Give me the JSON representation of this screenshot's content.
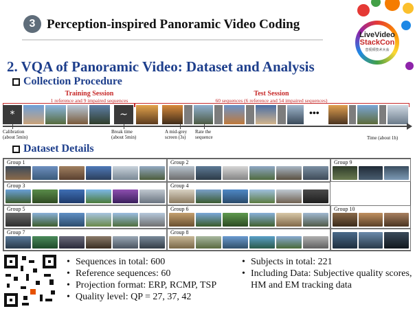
{
  "header": {
    "section_number": "3",
    "title": "Perception-inspired Panoramic Video Coding"
  },
  "logo": {
    "line1": "LiveVideo",
    "line2": "StackCon",
    "line3": "音视频技术大会"
  },
  "slide_title": "2. VQA of Panoramic Video: Dataset and Analysis",
  "collection": {
    "heading": "Collection Procedure",
    "training_label": "Training Session",
    "training_note": "1 reference and 9 impaired sequences",
    "test_label": "Test Session",
    "test_note": "60 sequences (6 reference and 54 impaired sequences)",
    "calibration_symbol": "*",
    "break_symbol": "~",
    "ellipsis": "•••",
    "calibration_line1": "Calibration",
    "calibration_line2": "(about 5min)",
    "break_line1": "Break time",
    "break_line2": "(about 5min)",
    "grey_line1": "A mid-grey",
    "grey_line2": "screen (3s)",
    "rate_line1": "Rate the",
    "rate_line2": "sequence",
    "time_note": "Time (about 1h)"
  },
  "details": {
    "heading": "Dataset Details",
    "groups": [
      "Group 1",
      "Group 2",
      "Group 3",
      "Group 4",
      "Group 5",
      "Group 6",
      "Group 7",
      "Group 8",
      "Group 9",
      "Group 10"
    ]
  },
  "bullets_left": [
    "Sequences in total: 600",
    "Reference sequences: 60",
    "Projection format: ERP, RCMP, TSP",
    "Quality level: QP = 27, 37, 42"
  ],
  "bullets_right": [
    "Subjects in total: 221",
    "Including Data: Subjective quality scores, HM and EM tracking data"
  ],
  "colors": {
    "title_blue": "#1e3f8c",
    "session_red": "#c62828"
  }
}
